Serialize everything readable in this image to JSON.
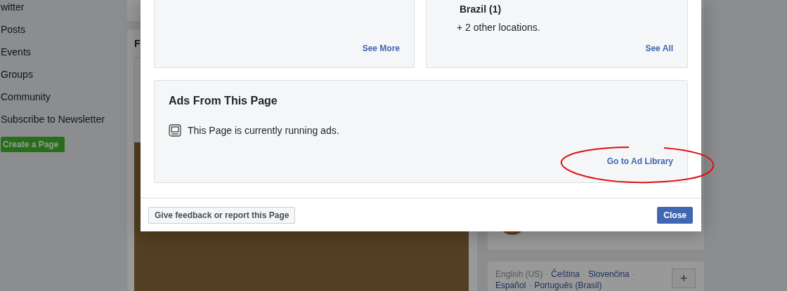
{
  "sidebar": {
    "items": [
      "witter",
      "Posts",
      "Events",
      "Groups",
      "Community",
      "Subscribe to Newsletter"
    ],
    "create_button": "Create a Page"
  },
  "feed": {
    "card_title": "F"
  },
  "languages": {
    "separator": "·",
    "items": [
      {
        "label": "English (US)",
        "current": true
      },
      {
        "label": "Čeština",
        "current": false
      },
      {
        "label": "Slovenčina",
        "current": false
      },
      {
        "label": "Español",
        "current": false
      },
      {
        "label": "Português (Brasil)",
        "current": false
      }
    ],
    "add_button": "+"
  },
  "dialog": {
    "cards": [
      {
        "link": "See More"
      },
      {
        "lines": [
          {
            "text": "Brazil (1)",
            "kind": "heading"
          },
          {
            "text": "+ 2 other locations.",
            "kind": "note"
          }
        ],
        "link": "See All"
      }
    ],
    "ads": {
      "title": "Ads From This Page",
      "status": "This Page is currently running ads.",
      "link": "Go to Ad Library"
    },
    "feedback_button": "Give feedback or report this Page",
    "close_button": "Close"
  }
}
